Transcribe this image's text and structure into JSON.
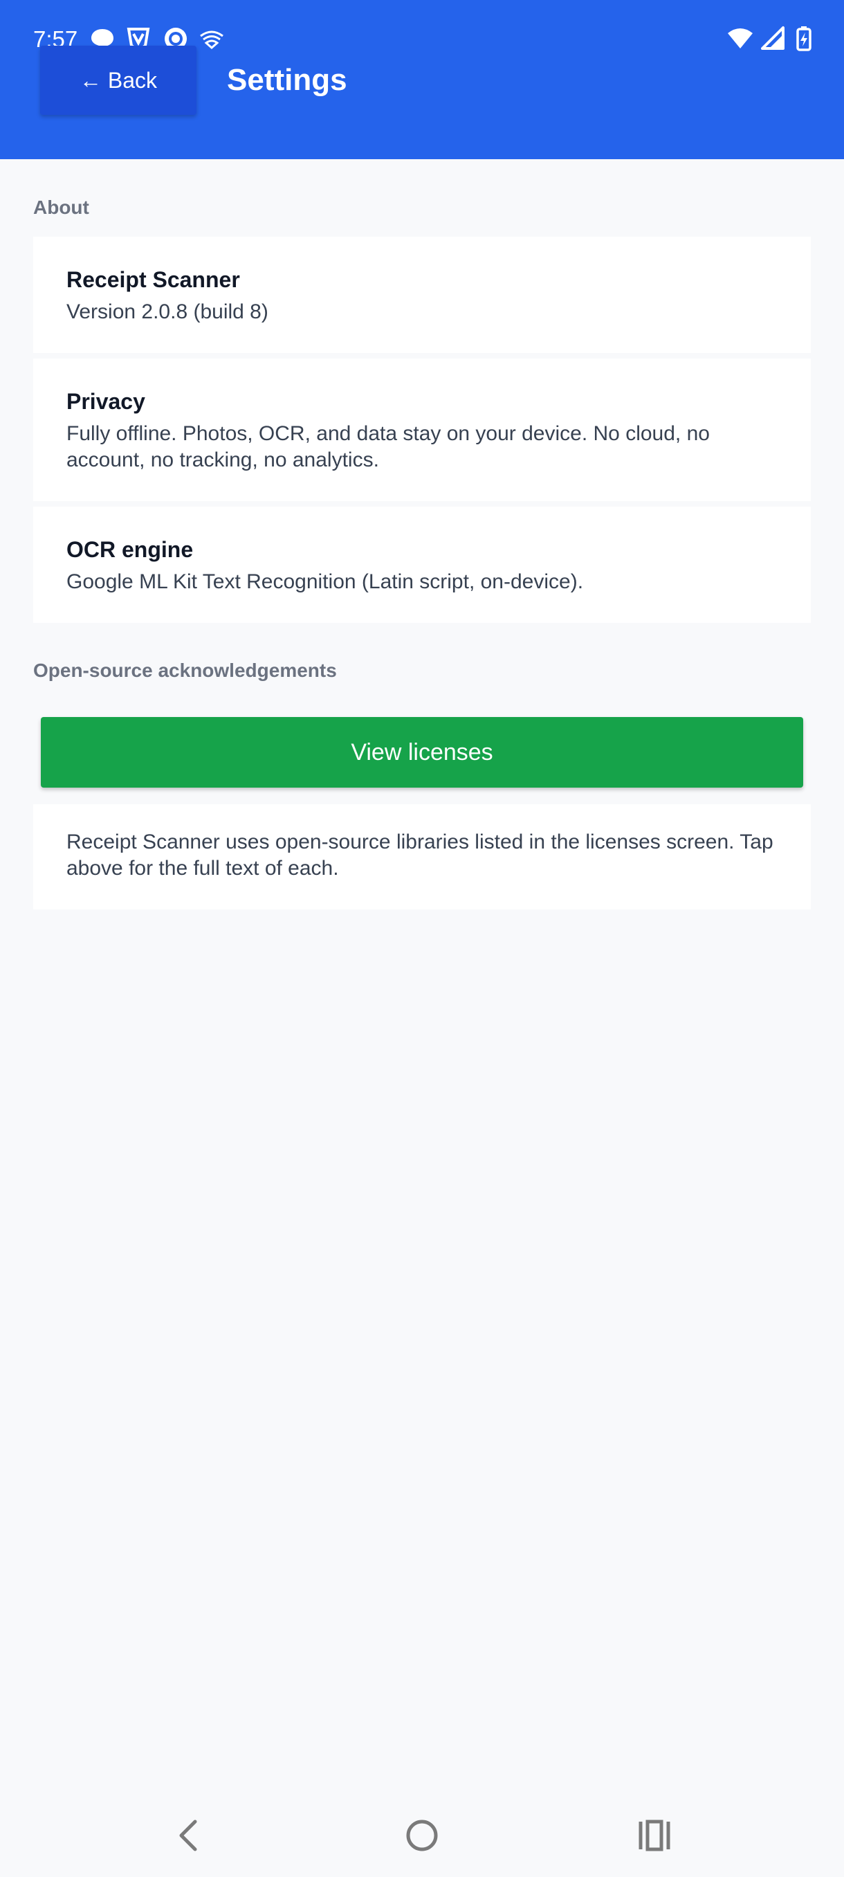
{
  "status_bar": {
    "time": "7:57",
    "left_icons": [
      "chat-bubble-icon",
      "shield-v-icon",
      "target-circle-icon",
      "stacked-wifi-icon"
    ],
    "right_icons": [
      "wifi-icon",
      "signal-icon",
      "battery-charging-icon"
    ]
  },
  "header": {
    "back_label": "← Back",
    "title": "Settings",
    "background_color": "#2563eb",
    "back_button_color": "#1d4ed8"
  },
  "about": {
    "heading": "About",
    "cards": [
      {
        "title": "Receipt Scanner",
        "body": "Version 2.0.8 (build 8)"
      },
      {
        "title": "Privacy",
        "body": "Fully offline. Photos, OCR, and data stay on your device. No cloud, no account, no tracking, no analytics."
      },
      {
        "title": "OCR engine",
        "body": "Google ML Kit Text Recognition (Latin script, on-device)."
      }
    ]
  },
  "licenses": {
    "heading": "Open-source acknowledgements",
    "button_label": "View licenses",
    "button_color": "#16a34a",
    "note": "Receipt Scanner uses open-source libraries listed in the licenses screen. Tap above for the full text of each."
  },
  "nav_bar": {
    "icons": [
      "back-triangle-icon",
      "home-circle-icon",
      "recents-icon"
    ]
  }
}
